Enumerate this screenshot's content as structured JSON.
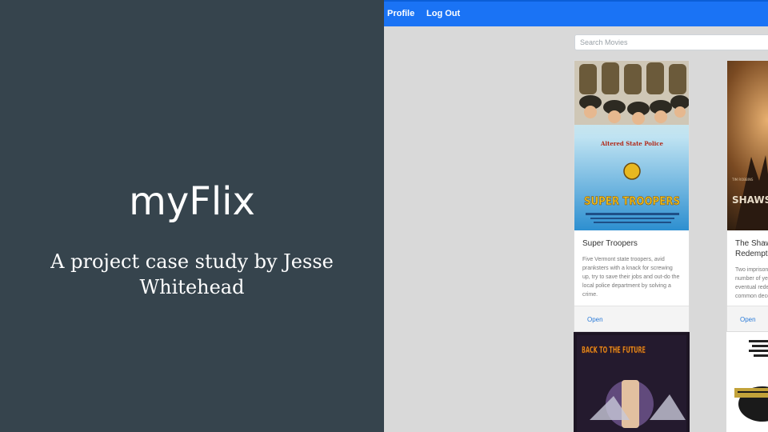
{
  "slide": {
    "title": "myFlix",
    "subtitle": "A project case study by Jesse Whitehead"
  },
  "app": {
    "nav": {
      "profile": "Profile",
      "logout": "Log Out"
    },
    "search": {
      "placeholder": "Search Movies"
    },
    "movies": [
      {
        "title": "Super Troopers",
        "description": "Five Vermont state troopers, avid pranksters with a knack for screwing up, try to save their jobs and out-do the local police department by solving a crime.",
        "action": "Open",
        "poster": {
          "headline": "SUPER TROOPERS",
          "tagline": "Altered State Police"
        }
      },
      {
        "title": "The Shawshank Redemption",
        "description": "Two imprisoned men bond over a number of years, finding solace and eventual redemption through acts of common decency.",
        "action": "Open",
        "poster": {
          "headline": "SHAWSHANK"
        }
      },
      {
        "title": "Back to the Future",
        "poster": {
          "headline": "BACK TO THE FUTURE"
        }
      }
    ]
  },
  "colors": {
    "left_panel": "#36444d",
    "navbar": "#1a73f5",
    "link": "#2b7bd8"
  }
}
